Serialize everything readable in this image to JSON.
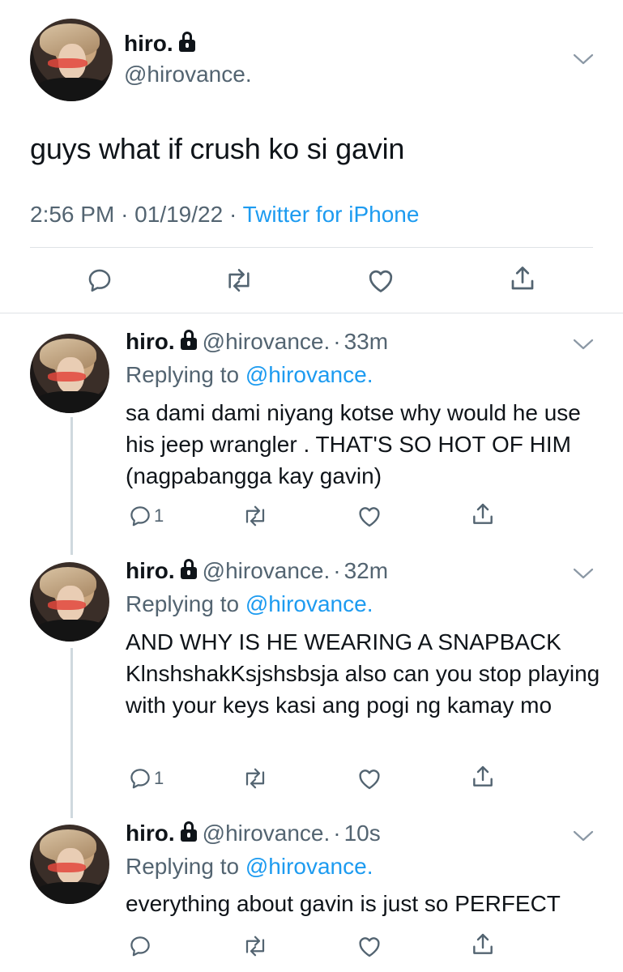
{
  "main_tweet": {
    "display_name": "hiro.",
    "handle": "@hirovance.",
    "text": "guys what if crush ko si gavin",
    "time": "2:56 PM",
    "date": "01/19/22",
    "source": "Twitter for iPhone",
    "separator": "·"
  },
  "replies": [
    {
      "display_name": "hiro.",
      "handle": "@hirovance.",
      "time_ago": "33m",
      "replying_prefix": "Replying to",
      "replying_to": "@hirovance.",
      "text": "sa dami dami niyang kotse why would he use his jeep wrangler . THAT'S SO HOT OF HIM (nagpabangga kay gavin)",
      "reply_count": "1"
    },
    {
      "display_name": "hiro.",
      "handle": "@hirovance.",
      "time_ago": "32m",
      "replying_prefix": "Replying to",
      "replying_to": "@hirovance.",
      "text": "AND WHY IS HE WEARING A SNAPBACK KlnshshakKsjshsbsja also can you stop playing with your keys kasi ang pogi ng kamay mo",
      "reply_count": "1"
    },
    {
      "display_name": "hiro.",
      "handle": "@hirovance.",
      "time_ago": "10s",
      "replying_prefix": "Replying to",
      "replying_to": "@hirovance.",
      "text": "everything about gavin is just so PERFECT",
      "reply_count": ""
    }
  ],
  "icons": {
    "reply": "reply-icon",
    "retweet": "retweet-icon",
    "like": "heart-icon",
    "share": "share-icon",
    "lock": "lock-icon",
    "more": "chevron-down-icon"
  },
  "colors": {
    "text": "#0f1419",
    "secondary": "#536471",
    "link": "#1d9bf0",
    "thread_line": "#cfd9de"
  }
}
